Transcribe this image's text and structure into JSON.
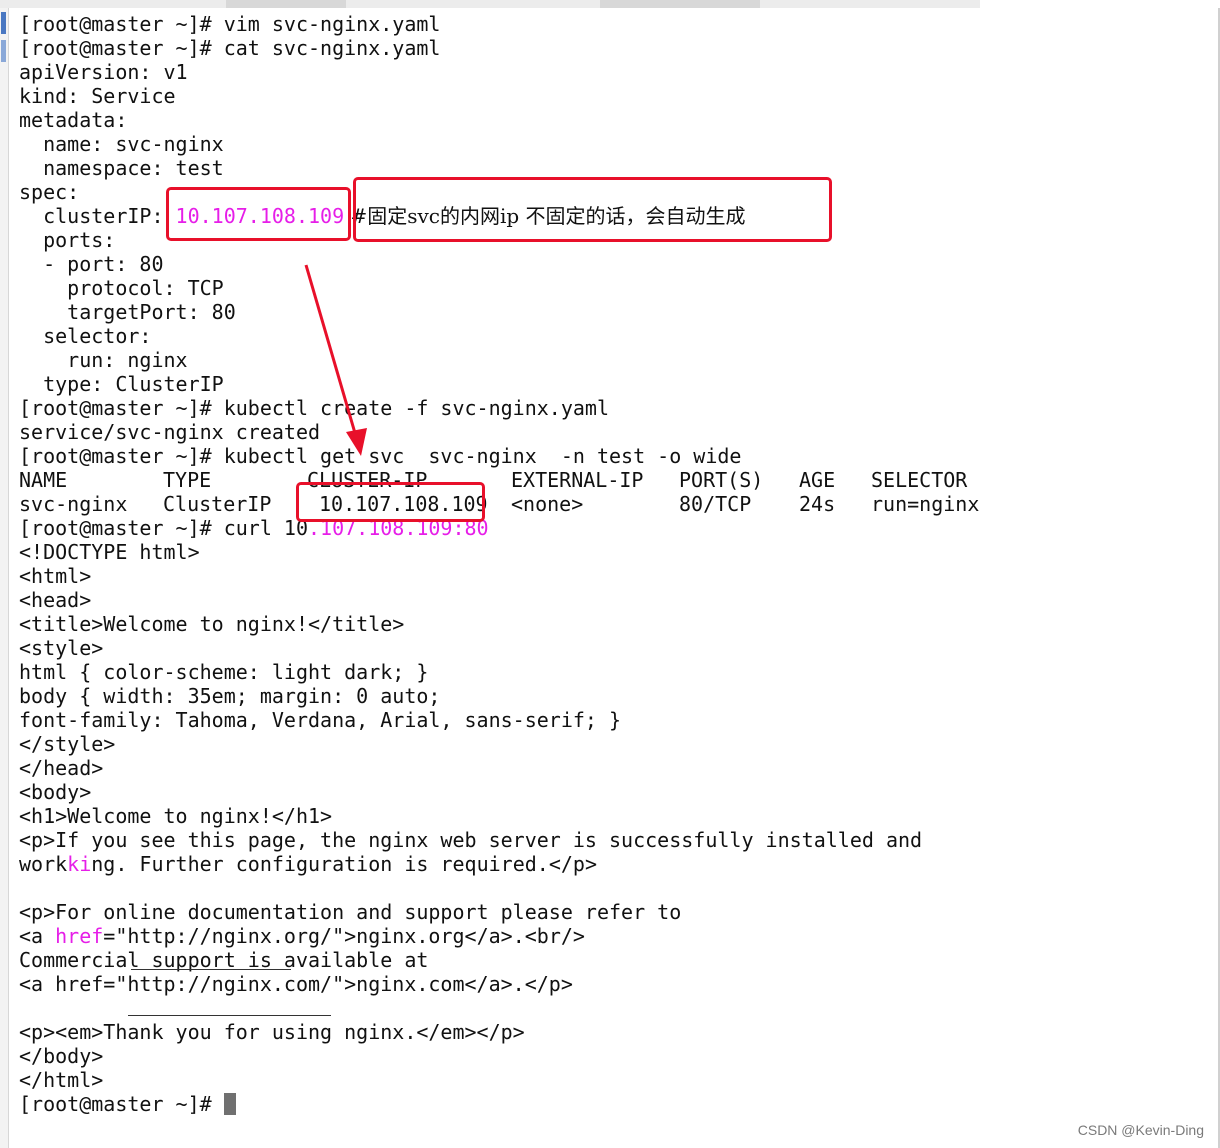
{
  "terminal": {
    "lines": {
      "l1": "[root@master ~]# vim svc-nginx.yaml",
      "l2": "[root@master ~]# cat svc-nginx.yaml",
      "l3": "apiVersion: v1",
      "l4": "kind: Service",
      "l5": "metadata:",
      "l6": "  name: svc-nginx",
      "l7": "  namespace: test",
      "l8": "spec:",
      "l9_key": "  clusterIP: ",
      "l9_ip": "10.107.108.109",
      "l9_comment": " #固定svc的内网ip 不固定的话，会自动生成",
      "l10": "  ports:",
      "l11": "  - port: 80",
      "l12": "    protocol: TCP",
      "l13": "    targetPort: 80",
      "l14": "  selector:",
      "l15": "    run: nginx",
      "l16": "  type: ClusterIP",
      "l17": "[root@master ~]# kubectl create -f svc-nginx.yaml",
      "l18": "service/svc-nginx created",
      "l19": "[root@master ~]# kubectl get svc  svc-nginx  -n test -o wide",
      "l22_prefix": "[root@master ~]# curl 10",
      "l22_ip": ".107.108.109:80",
      "l23": "<!DOCTYPE html>",
      "l24": "<html>",
      "l25": "<head>",
      "l26": "<title>Welcome to nginx!</title>",
      "l27": "<style>",
      "l28": "html { color-scheme: light dark; }",
      "l29": "body { width: 35em; margin: 0 auto;",
      "l30": "font-family: Tahoma, Verdana, Arial, sans-serif; }",
      "l31": "</style>",
      "l32": "</head>",
      "l33": "<body>",
      "l34": "<h1>Welcome to nginx!</h1>",
      "l35": "<p>If you see this page, the nginx web server is successfully installed and",
      "l36_a": "work",
      "l36_b": "ki",
      "l36_c": "ng. Further configuration is required.</p>",
      "l37": "",
      "l38": "<p>For online documentation and support please refer to",
      "l39_a": "<a ",
      "l39_b": "href",
      "l39_c": "=\"http://nginx.org/\">nginx.org</a>.<br/>",
      "l40": "Commercial support is available at",
      "l41": "<a href=\"http://nginx.com/\">nginx.com</a>.</p>",
      "l42": "",
      "l43": "<p><em>Thank you for using nginx.</em></p>",
      "l44": "</body>",
      "l45": "</html>",
      "l46": "[root@master ~]# "
    },
    "table": {
      "headers": [
        "NAME",
        "TYPE",
        "CLUSTER-IP",
        "EXTERNAL-IP",
        "PORT(S)",
        "AGE",
        "SELECTOR"
      ],
      "row": [
        "svc-nginx",
        "ClusterIP",
        "10.107.108.109",
        "<none>",
        "80/TCP",
        "24s",
        "run=nginx"
      ]
    }
  },
  "watermark": "CSDN @Kevin-Ding",
  "colors": {
    "highlight_ip": "#e61ee8",
    "annotation_red": "#e8102a",
    "terminal_text": "#111111",
    "background": "#ffffff"
  }
}
